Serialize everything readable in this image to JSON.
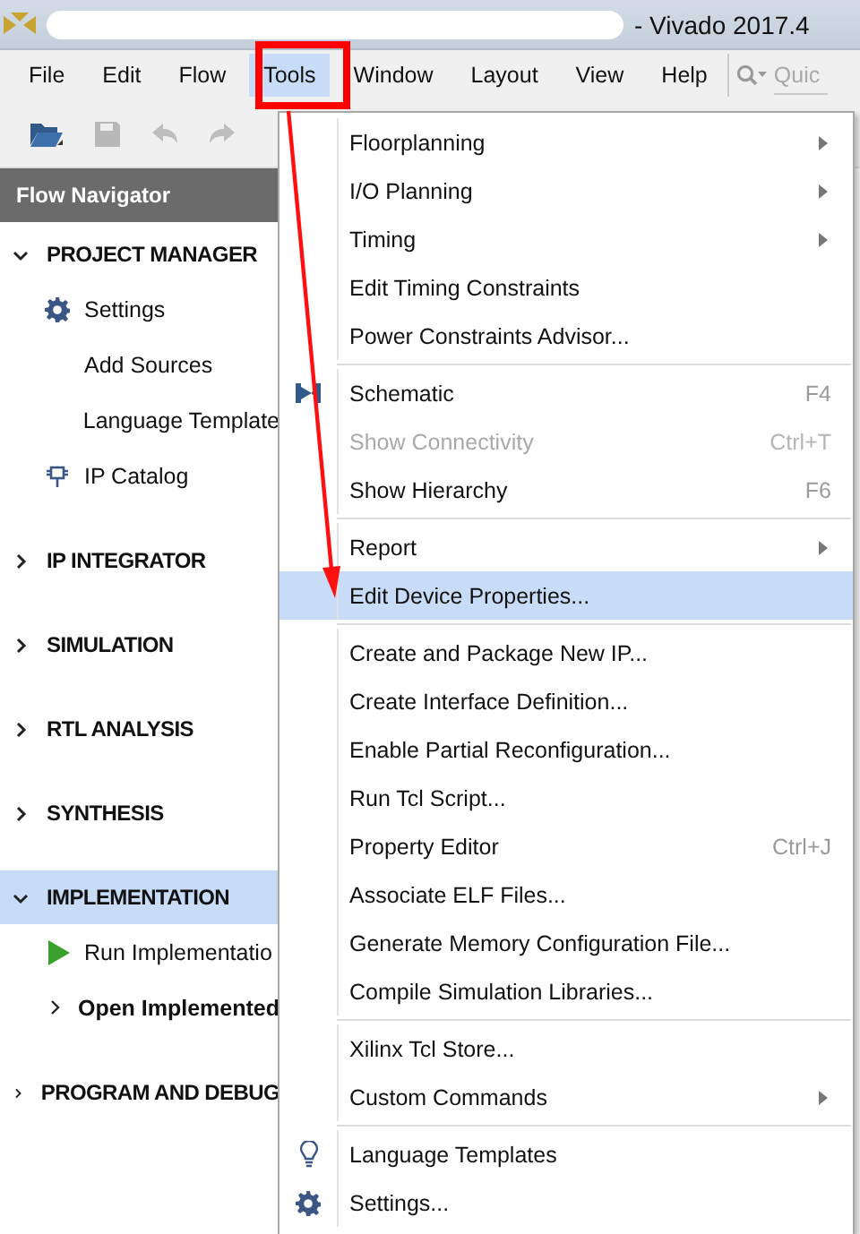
{
  "window": {
    "title": "- Vivado 2017.4"
  },
  "menu_bar": [
    {
      "label": "File",
      "selected": false
    },
    {
      "label": "Edit",
      "selected": false
    },
    {
      "label": "Flow",
      "selected": false
    },
    {
      "label": "Tools",
      "selected": true
    },
    {
      "label": "Window",
      "selected": false
    },
    {
      "label": "Layout",
      "selected": false
    },
    {
      "label": "View",
      "selected": false
    },
    {
      "label": "Help",
      "selected": false
    }
  ],
  "search": {
    "placeholder": "Quic"
  },
  "toolbar": [
    {
      "kind": "open",
      "disabled": false
    },
    {
      "kind": "save",
      "disabled": true
    },
    {
      "kind": "undo",
      "disabled": true
    },
    {
      "kind": "redo",
      "disabled": true
    }
  ],
  "flow_navigator": {
    "title": "Flow Navigator",
    "sections": [
      {
        "title": "PROJECT MANAGER",
        "expanded": true,
        "selected": false,
        "children": [
          {
            "label": "Settings",
            "kind": "settings"
          },
          {
            "label": "Add Sources",
            "kind": "plain"
          },
          {
            "label": "Language Template",
            "kind": "plain"
          },
          {
            "label": "IP Catalog",
            "kind": "ip"
          }
        ]
      },
      {
        "title": "IP INTEGRATOR",
        "expanded": false,
        "selected": false
      },
      {
        "title": "SIMULATION",
        "expanded": false,
        "selected": false
      },
      {
        "title": "RTL ANALYSIS",
        "expanded": false,
        "selected": false
      },
      {
        "title": "SYNTHESIS",
        "expanded": false,
        "selected": false
      },
      {
        "title": "IMPLEMENTATION",
        "expanded": true,
        "selected": true,
        "children": [
          {
            "label": "Run Implementatio",
            "kind": "run"
          },
          {
            "label": "Open Implemented",
            "kind": "group",
            "expanded": false
          }
        ]
      },
      {
        "title": "PROGRAM AND DEBUG",
        "expanded": false,
        "selected": false
      }
    ]
  },
  "tools_menu": [
    {
      "kind": "item",
      "label": "Floorplanning",
      "submenu": true,
      "disabled": false,
      "selected": false
    },
    {
      "kind": "item",
      "label": "I/O Planning",
      "submenu": true,
      "disabled": false,
      "selected": false
    },
    {
      "kind": "item",
      "label": "Timing",
      "submenu": true,
      "disabled": false,
      "selected": false
    },
    {
      "kind": "item",
      "label": "Edit Timing Constraints",
      "submenu": false,
      "disabled": false,
      "selected": false
    },
    {
      "kind": "item",
      "label": "Power Constraints Advisor...",
      "submenu": false,
      "disabled": false,
      "selected": false
    },
    {
      "kind": "separator"
    },
    {
      "kind": "schematic",
      "label": "Schematic",
      "shortcut": "F4",
      "submenu": false,
      "disabled": false,
      "selected": false
    },
    {
      "kind": "item",
      "label": "Show Connectivity",
      "shortcut": "Ctrl+T",
      "submenu": false,
      "disabled": true,
      "selected": false
    },
    {
      "kind": "item",
      "label": "Show Hierarchy",
      "shortcut": "F6",
      "submenu": false,
      "disabled": false,
      "selected": false
    },
    {
      "kind": "separator"
    },
    {
      "kind": "item",
      "label": "Report",
      "submenu": true,
      "disabled": false,
      "selected": false
    },
    {
      "kind": "item",
      "label": "Edit Device Properties...",
      "submenu": false,
      "disabled": false,
      "selected": true
    },
    {
      "kind": "separator"
    },
    {
      "kind": "item",
      "label": "Create and Package New IP...",
      "submenu": false,
      "disabled": false,
      "selected": false
    },
    {
      "kind": "item",
      "label": "Create Interface Definition...",
      "submenu": false,
      "disabled": false,
      "selected": false
    },
    {
      "kind": "item",
      "label": "Enable Partial Reconfiguration...",
      "submenu": false,
      "disabled": false,
      "selected": false
    },
    {
      "kind": "item",
      "label": "Run Tcl Script...",
      "submenu": false,
      "disabled": false,
      "selected": false
    },
    {
      "kind": "item",
      "label": "Property Editor",
      "shortcut": "Ctrl+J",
      "submenu": false,
      "disabled": false,
      "selected": false
    },
    {
      "kind": "item",
      "label": "Associate ELF Files...",
      "submenu": false,
      "disabled": false,
      "selected": false
    },
    {
      "kind": "item",
      "label": "Generate Memory Configuration File...",
      "submenu": false,
      "disabled": false,
      "selected": false
    },
    {
      "kind": "item",
      "label": "Compile Simulation Libraries...",
      "submenu": false,
      "disabled": false,
      "selected": false
    },
    {
      "kind": "separator"
    },
    {
      "kind": "item",
      "label": "Xilinx Tcl Store...",
      "submenu": false,
      "disabled": false,
      "selected": false
    },
    {
      "kind": "item",
      "label": "Custom Commands",
      "submenu": true,
      "disabled": false,
      "selected": false
    },
    {
      "kind": "separator"
    },
    {
      "kind": "template",
      "label": "Language Templates",
      "submenu": false,
      "disabled": false,
      "selected": false
    },
    {
      "kind": "settings",
      "label": "Settings...",
      "submenu": false,
      "disabled": false,
      "selected": false
    }
  ]
}
